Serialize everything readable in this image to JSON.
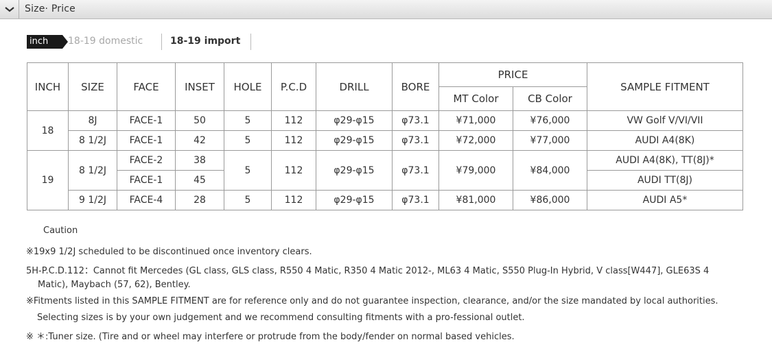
{
  "header": {
    "title": "Size· Price",
    "toggle_icon": "chevron-down-icon"
  },
  "tabs": {
    "active": "inch",
    "domestic": "18-19 domestic",
    "import": "18-19 import"
  },
  "table": {
    "headers": {
      "inch": "INCH",
      "size": "SIZE",
      "face": "FACE",
      "inset": "INSET",
      "hole": "HOLE",
      "pcd": "P.C.D",
      "drill": "DRILL",
      "bore": "BORE",
      "price": "PRICE",
      "mt": "MT Color",
      "cb": "CB Color",
      "fitment": "SAMPLE FITMENT"
    },
    "rows": [
      {
        "inch": "18",
        "size": "8J",
        "face": "FACE-1",
        "inset": "50",
        "hole": "5",
        "pcd": "112",
        "drill": "φ29-φ15",
        "bore": "φ73.1",
        "mt": "¥71,000",
        "cb": "¥76,000",
        "fitment": "VW Golf V/VI/VII"
      },
      {
        "size": "8 1/2J",
        "face": "FACE-1",
        "inset": "42",
        "hole": "5",
        "pcd": "112",
        "drill": "φ29-φ15",
        "bore": "φ73.1",
        "mt": "¥72,000",
        "cb": "¥77,000",
        "fitment": "AUDI A4(8K)"
      },
      {
        "inch": "19",
        "size": "8 1/2J",
        "face": "FACE-2",
        "inset": "38",
        "hole": "5",
        "pcd": "112",
        "drill": "φ29-φ15",
        "bore": "φ73.1",
        "mt": "¥79,000",
        "cb": "¥84,000",
        "fitment": "AUDI A4(8K), TT(8J)*"
      },
      {
        "face": "FACE-1",
        "inset": "45",
        "fitment": "AUDI TT(8J)"
      },
      {
        "size": "9 1/2J",
        "face": "FACE-4",
        "inset": "28",
        "hole": "5",
        "pcd": "112",
        "drill": "φ29-φ15",
        "bore": "φ73.1",
        "mt": "¥81,000",
        "cb": "¥86,000",
        "fitment": "AUDI A5*"
      }
    ]
  },
  "notes": {
    "caution": "Caution",
    "discontinued": "※19x9 1/2J scheduled to be discontinued once inventory clears.",
    "pcd_line1": "5H-P.C.D.112：Cannot fit Mercedes (GL class, GLS class, R550 4 Matic, R350 4 Matic 2012-, ML63 4 Matic, S550 Plug-In Hybrid, V class[W447], GLE63S 4",
    "pcd_line2": "Matic), Maybach (57, 62), Bentley.",
    "fitment_line1": "※Fitments listed in this SAMPLE FITMENT are for reference only and do not guarantee inspection, clearance, and/or the size mandated by local authorities.",
    "fitment_line2": "Selecting sizes is by your own judgement and we recommend consulting fitments with a pro-fessional outlet.",
    "tuner": "※ ＊:Tuner size. (Tire and or wheel may interfere or protrude from the body/fender on normal based vehicles."
  }
}
